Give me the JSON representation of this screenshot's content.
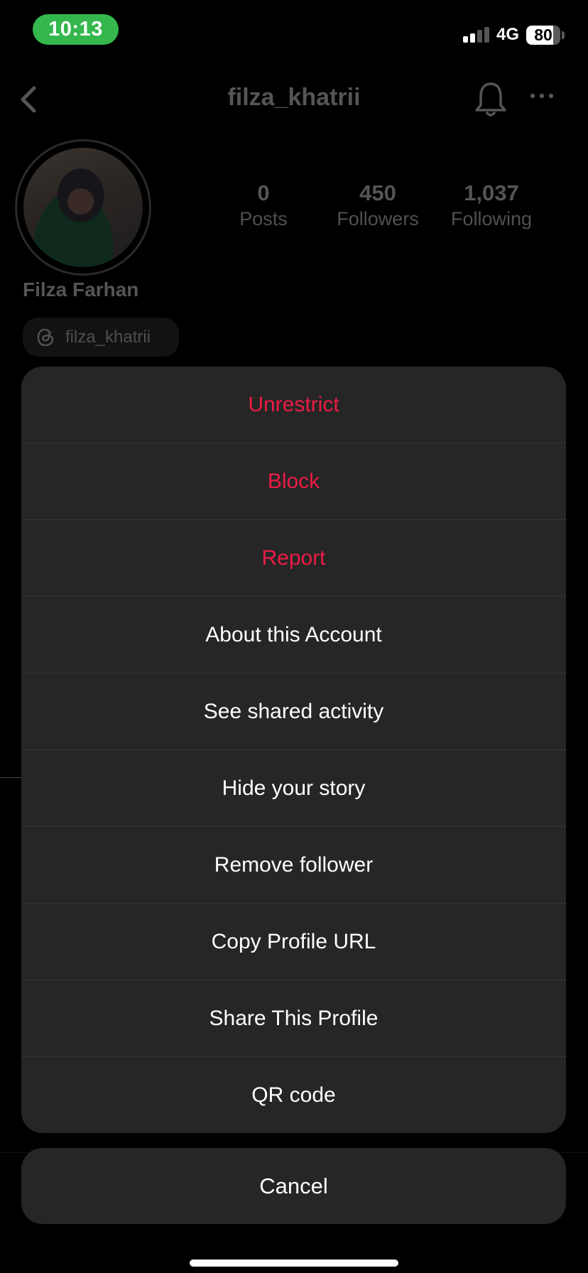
{
  "status_bar": {
    "time": "10:13",
    "time_pill_color": "#34b84d",
    "network": "4G",
    "battery_percent": 80,
    "battery_label": "80",
    "signal_bars_active": 2,
    "signal_bars_total": 4
  },
  "header": {
    "back_icon": "chevron-left-icon",
    "username": "filza_khatrii",
    "bell_icon": "bell-icon",
    "more_icon": "more-horizontal-icon"
  },
  "profile": {
    "display_name": "Filza Farhan",
    "avatar": "profile-photo",
    "stats": [
      {
        "value": "0",
        "label": "Posts"
      },
      {
        "value": "450",
        "label": "Followers"
      },
      {
        "value": "1,037",
        "label": "Following"
      }
    ],
    "threads_badge": {
      "icon": "threads-icon",
      "label": "filza_khatrii"
    }
  },
  "action_sheet": {
    "danger_color": "#ed1b45",
    "items": [
      {
        "label": "Unrestrict",
        "style": "danger"
      },
      {
        "label": "Block",
        "style": "danger"
      },
      {
        "label": "Report",
        "style": "danger"
      },
      {
        "label": "About this Account",
        "style": "default"
      },
      {
        "label": "See shared activity",
        "style": "default"
      },
      {
        "label": "Hide your story",
        "style": "default"
      },
      {
        "label": "Remove follower",
        "style": "default"
      },
      {
        "label": "Copy Profile URL",
        "style": "default"
      },
      {
        "label": "Share This Profile",
        "style": "default"
      },
      {
        "label": "QR code",
        "style": "default"
      }
    ],
    "cancel_label": "Cancel"
  }
}
